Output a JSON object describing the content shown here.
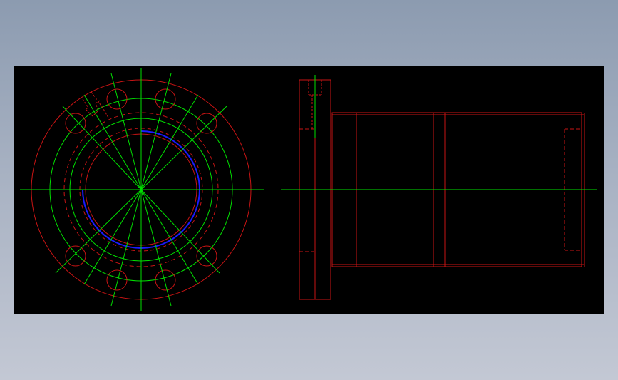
{
  "drawing": {
    "background_color": "#000000",
    "page_gradient": [
      "#8c9bb0",
      "#c3c8d4"
    ],
    "colors": {
      "outline": "#c81414",
      "centerline": "#00e000",
      "thread": "#1a1aff"
    },
    "views": [
      {
        "id": "front-view",
        "kind": "flange end view with bolt circle"
      },
      {
        "id": "side-view",
        "kind": "side elevation of flanged nut body"
      }
    ],
    "bolt_holes_count": 8
  }
}
